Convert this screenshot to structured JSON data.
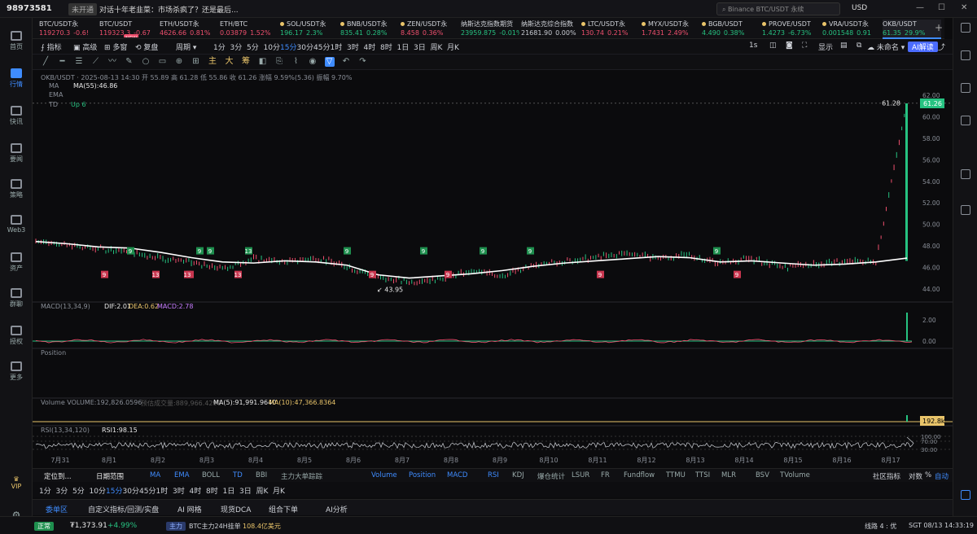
{
  "topbar": {
    "user_id": "98973581",
    "badge": "未开通",
    "news": "对话十年老韭菜：市场杀疯了？还是最后...",
    "search_placeholder": "Binance BTC/USDT 永续",
    "currency": "USD",
    "minimize": "—",
    "maximize": "☐",
    "close": "✕"
  },
  "sidebar": {
    "items": [
      "首页",
      "行情",
      "快讯",
      "要闻",
      "策略",
      "Web3",
      "资产",
      "群聊",
      "授权",
      "更多"
    ],
    "vip": "VIP"
  },
  "tickers": [
    {
      "name": "BTC/USDT永",
      "price": "119270.3",
      "change": "-0.6!",
      "dir": "dn",
      "dot": false
    },
    {
      "name": "BTC/USDT",
      "price": "119323.3",
      "change": "-0.67",
      "dir": "dn",
      "dot": false,
      "new": "NEW"
    },
    {
      "name": "ETH/USDT永",
      "price": "4626.66",
      "change": "0.81%",
      "dir": "dn",
      "dot": false
    },
    {
      "name": "ETH/BTC",
      "price": "0.03879",
      "change": "1.52%",
      "dir": "dn",
      "dot": false
    },
    {
      "name": "SOL/USDT永",
      "price": "196.17",
      "change": "2.3%",
      "dir": "up",
      "dot": true
    },
    {
      "name": "BNB/USDT永",
      "price": "835.41",
      "change": "0.28%",
      "dir": "up",
      "dot": true
    },
    {
      "name": "ZEN/USDT永",
      "price": "8.458",
      "change": "0.36%",
      "dir": "dn",
      "dot": true
    },
    {
      "name": "纳斯达克指数期货",
      "price": "23959.875",
      "change": "-0.01%",
      "dir": "up",
      "dot": false
    },
    {
      "name": "纳斯达克综合指数",
      "price": "21681.90",
      "change": "0.00%",
      "dir": "n",
      "dot": false
    },
    {
      "name": "LTC/USDT永",
      "price": "130.74",
      "change": "0.21%",
      "dir": "dn",
      "dot": true
    },
    {
      "name": "MYX/USDT永",
      "price": "1.7431",
      "change": "2.49%",
      "dir": "dn",
      "dot": true
    },
    {
      "name": "BGB/USDT",
      "price": "4.490",
      "change": "0.38%",
      "dir": "up",
      "dot": true
    },
    {
      "name": "PROVE/USDT",
      "price": "1.4273",
      "change": "-6.73%",
      "dir": "up",
      "dot": true
    },
    {
      "name": "VRA/USDT永",
      "price": "0.001548",
      "change": "0.91",
      "dir": "up",
      "dot": true
    },
    {
      "name": "OKB/USDT",
      "price": "61.35",
      "change": "29.9%",
      "dir": "up",
      "dot": false,
      "active": true
    }
  ],
  "toolbar1": {
    "indicator": "指标",
    "advanced": "高级",
    "multi": "多窗",
    "replay": "复盘",
    "period": "周期",
    "intervals": [
      "1分",
      "3分",
      "5分",
      "10分",
      "15分",
      "30分",
      "45分",
      "1时",
      "3时",
      "4时",
      "8时",
      "1日",
      "3日",
      "周K",
      "月K"
    ],
    "active_interval": "15分",
    "speed": "1s",
    "display": "显示",
    "unnamed": "未命名",
    "ai": "AI解读"
  },
  "toolbar2": {
    "tools": [
      "╱",
      "━",
      "☰",
      "⟋",
      "〰",
      "✎",
      "○",
      "▭",
      "⊕",
      "⊞",
      "主",
      "大",
      "筹",
      "◧",
      "⎘",
      "⌇",
      "◉",
      "▽",
      "↶",
      "↷"
    ]
  },
  "chart": {
    "header": "OKB/USDT · 2025-08-13 14:30  开 55.89  高 61.28  低 55.86  收 61.26  涨幅 9.59%(5.36)  振幅 9.70%",
    "ma_label": "MA",
    "ma_value": "MA(55):46.86",
    "ema_label": "EMA",
    "td_label": "TD",
    "td_value": "Up 6",
    "macd_label": "MACD(13,34,9)",
    "dif": "DIF:2.01",
    "dea": "DEA:0.62",
    "macd": "MACD:2.78",
    "position_label": "Position",
    "volume_label": "Volume  VOLUME:192,826.0596",
    "volume_pred": "预估成交量:889,966.4290",
    "ma5": "MA(5):91,991.9640",
    "ma10": "MA(10):47,366.8364",
    "rsi_label": "RSI(13,34,120)",
    "rsi_value": "RSI1:98.15",
    "high_marker": "61.28",
    "low_marker": "43.95",
    "last_price": "61.26",
    "vol_tag": "192.8k"
  },
  "chart_data": {
    "type": "candlestick",
    "x_dates": [
      "7月31",
      "8月1",
      "8月2",
      "8月3",
      "8月4",
      "8月5",
      "8月6",
      "8月7",
      "8月8",
      "8月9",
      "8月10",
      "8月11",
      "8月12",
      "8月13",
      "8月14",
      "8月15",
      "8月16",
      "8月17"
    ],
    "price_axis": [
      "62.00",
      "60.00",
      "58.00",
      "56.00",
      "54.00",
      "52.00",
      "50.00",
      "48.00",
      "46.00",
      "44.00"
    ],
    "ylim": [
      43,
      63
    ],
    "ma_series": [
      48.4,
      48.2,
      47.9,
      47.8,
      47.4,
      46.9,
      46.5,
      46.4,
      46.6,
      46.5,
      46.2,
      45.3,
      45.0,
      45.2,
      45.4,
      45.7,
      46.1,
      46.4,
      46.6,
      46.8,
      47.0,
      46.9,
      46.5,
      46.6,
      46.4,
      46.2,
      46.3,
      46.5,
      46.86
    ],
    "close_series": [
      48.5,
      48.1,
      47.7,
      47.5,
      46.9,
      46.4,
      45.9,
      46.8,
      46.5,
      46.9,
      46.1,
      45.1,
      44.6,
      45.0,
      45.6,
      45.3,
      46.1,
      46.6,
      46.9,
      47.3,
      46.9,
      47.1,
      46.4,
      46.8,
      46.0,
      46.3,
      46.5,
      46.6,
      61.26
    ],
    "macd_axis": [
      "2.00",
      "0.00"
    ],
    "rsi_axis": [
      "100.00",
      "70.00",
      "30.00"
    ],
    "high": 61.28,
    "low": 43.95,
    "last": 61.26
  },
  "bottomtabs": {
    "locate": "定位到...",
    "date_range": "日期范围",
    "main_inds": [
      "MA",
      "EMA",
      "BOLL",
      "TD",
      "BBI",
      "主力大单踪踪"
    ],
    "sub_inds": [
      "Volume",
      "Position",
      "MACD",
      "RSI",
      "KDJ",
      "爆仓统计",
      "LSUR",
      "FR",
      "Fundflow",
      "TTMU",
      "TTSI",
      "MLR",
      "BSV",
      "TVolume"
    ],
    "community": "社区指标",
    "compare": "对数",
    "pct": "%",
    "auto": "自动"
  },
  "bottomtabs2": {
    "intervals": [
      "1分",
      "3分",
      "5分",
      "10分",
      "15分",
      "30分",
      "45分",
      "1时",
      "3时",
      "4时",
      "8时",
      "1日",
      "3日",
      "周K",
      "月K"
    ],
    "active": "15分"
  },
  "ordertabs": [
    "委单区",
    "自定义指标/回测/实盘",
    "AI 网格",
    "现货DCA",
    "组合下单",
    "AI分析"
  ],
  "status": {
    "state": "正常",
    "amount": "₮1,373.91",
    "change": "+4.99%",
    "main": "主力",
    "text": "BTC主力24H挂单",
    "value": "108.4亿美元",
    "route": "线路 4 : 优",
    "time": "SGT 08/13 14:33:19"
  }
}
